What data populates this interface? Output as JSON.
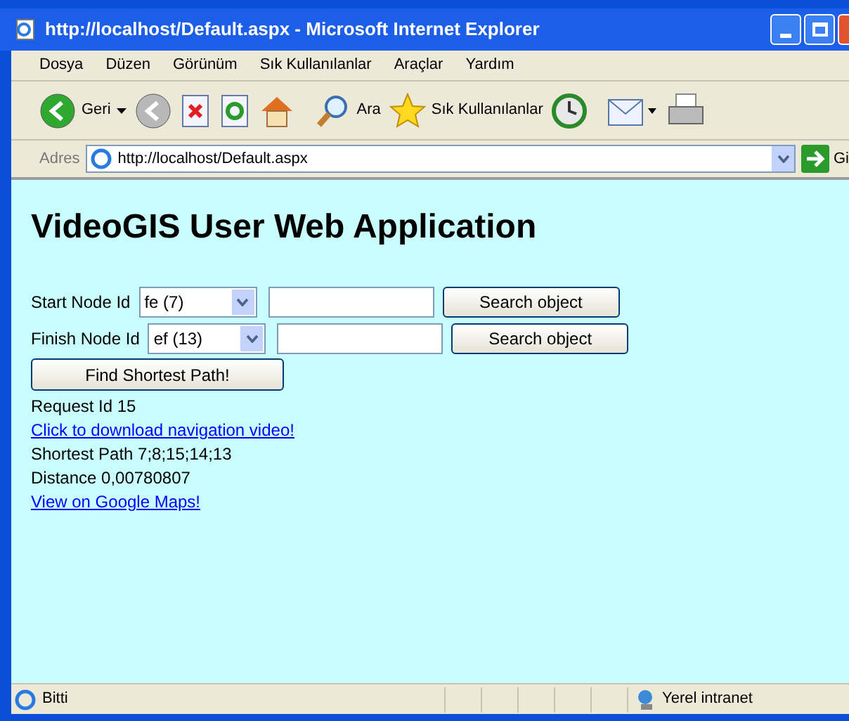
{
  "window": {
    "title": "http://localhost/Default.aspx - Microsoft Internet Explorer"
  },
  "menu": [
    "Dosya",
    "Düzen",
    "Görünüm",
    "Sık Kullanılanlar",
    "Araçlar",
    "Yardım"
  ],
  "toolbar": {
    "back": "Geri",
    "search": "Ara",
    "favorites": "Sık Kullanılanlar"
  },
  "address": {
    "label": "Adres",
    "value": "http://localhost/Default.aspx",
    "go": "Gi"
  },
  "page": {
    "heading": "VideoGIS User Web Application",
    "rows": [
      {
        "label": "Start Node Id",
        "select": "fe (7)",
        "button": "Search object"
      },
      {
        "label": "Finish Node Id",
        "select": "ef (13)",
        "button": "Search object"
      }
    ],
    "submit": "Find Shortest Path!",
    "results": [
      {
        "kind": "text",
        "text": "Request Id 15"
      },
      {
        "kind": "link",
        "text": "Click to download navigation video!"
      },
      {
        "kind": "text",
        "text": "Shortest Path 7;8;15;14;13"
      },
      {
        "kind": "text",
        "text": "Distance 0,00780807"
      },
      {
        "kind": "link",
        "text": "View on Google Maps!"
      }
    ]
  },
  "status_bar": {
    "text": "Bitti",
    "zone": "Yerel intranet"
  }
}
